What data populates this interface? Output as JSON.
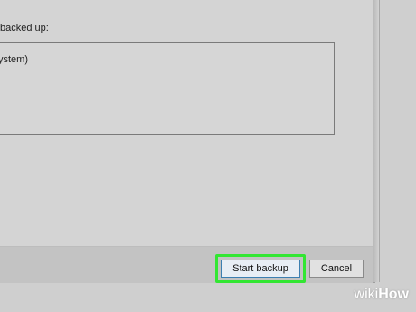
{
  "dialog": {
    "items_label": "backed up:",
    "items": [
      "ystem)"
    ]
  },
  "footer": {
    "start_label": "Start backup",
    "cancel_label": "Cancel"
  },
  "watermark": {
    "wiki": "wiki",
    "how": "How"
  },
  "colors": {
    "highlight": "#32e632",
    "background": "#d4d4d4"
  }
}
